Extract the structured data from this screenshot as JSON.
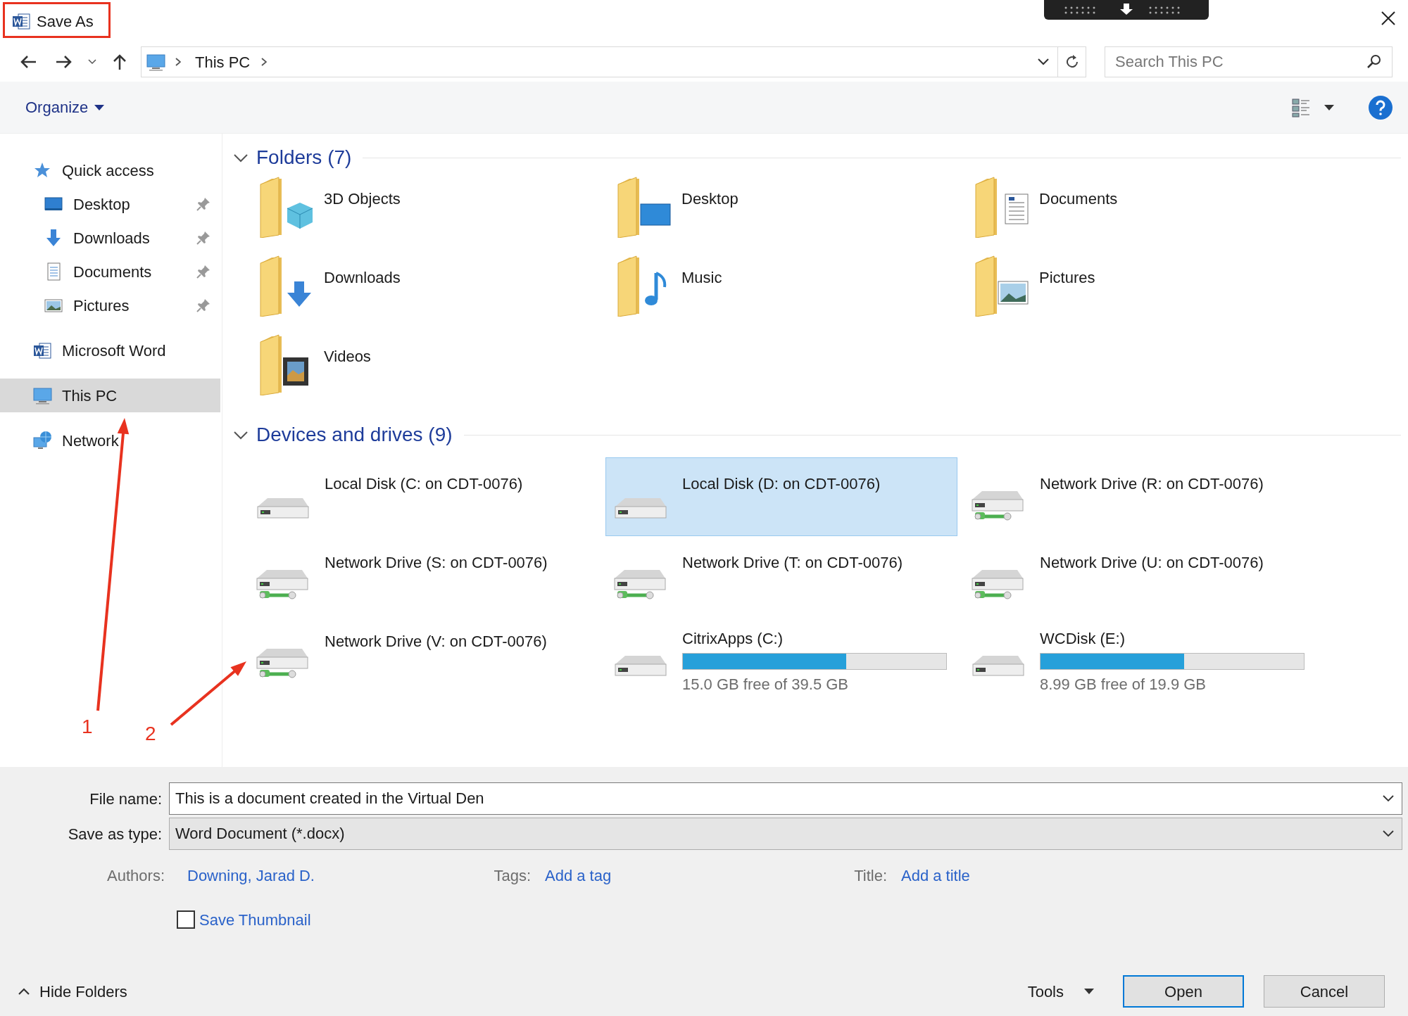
{
  "window": {
    "title": "Save As"
  },
  "address_bar": {
    "path": [
      "This PC"
    ],
    "search_placeholder": "Search This PC"
  },
  "toolbar": {
    "organize": "Organize"
  },
  "sidebar": {
    "items": [
      {
        "label": "Quick access",
        "kind": "star",
        "selected": false,
        "children": [
          {
            "label": "Desktop",
            "kind": "desktop",
            "selected": false,
            "pinned": true
          },
          {
            "label": "Downloads",
            "kind": "downloads",
            "selected": false,
            "pinned": true
          },
          {
            "label": "Documents",
            "kind": "documents",
            "selected": false,
            "pinned": true
          },
          {
            "label": "Pictures",
            "kind": "pictures",
            "selected": false,
            "pinned": true
          }
        ]
      },
      {
        "label": "Microsoft Word",
        "kind": "word",
        "selected": false
      },
      {
        "label": "This PC",
        "kind": "pc",
        "selected": true
      },
      {
        "label": "Network",
        "kind": "network",
        "selected": false
      }
    ]
  },
  "folders": {
    "header": "Folders (7)",
    "expanded": true,
    "items": [
      {
        "label": "3D Objects",
        "kind": "objects"
      },
      {
        "label": "Desktop",
        "kind": "desktop"
      },
      {
        "label": "Documents",
        "kind": "documents"
      },
      {
        "label": "Downloads",
        "kind": "downloads"
      },
      {
        "label": "Music",
        "kind": "music"
      },
      {
        "label": "Pictures",
        "kind": "pictures"
      },
      {
        "label": "Videos",
        "kind": "videos"
      }
    ]
  },
  "drives": {
    "header": "Devices and drives (9)",
    "expanded": true,
    "items": [
      {
        "label": "Local Disk (C: on CDT-0076)",
        "kind": "local",
        "selected": false
      },
      {
        "label": "Local Disk (D: on CDT-0076)",
        "kind": "local",
        "selected": true
      },
      {
        "label": "Network Drive (R: on CDT-0076)",
        "kind": "network",
        "selected": false
      },
      {
        "label": "Network Drive (S: on CDT-0076)",
        "kind": "network",
        "selected": false
      },
      {
        "label": "Network Drive (T: on CDT-0076)",
        "kind": "network",
        "selected": false
      },
      {
        "label": "Network Drive (U: on CDT-0076)",
        "kind": "network",
        "selected": false
      },
      {
        "label": "Network Drive (V: on CDT-0076)",
        "kind": "network",
        "selected": false
      },
      {
        "label": "CitrixApps (C:)",
        "kind": "local",
        "selected": false,
        "level": 0.62,
        "free": "15.0 GB free of 39.5 GB"
      },
      {
        "label": "WCDisk (E:)",
        "kind": "local",
        "selected": false,
        "level": 0.545,
        "free": "8.99 GB free of 19.9 GB"
      }
    ]
  },
  "form": {
    "file_name_label": "File name:",
    "file_name": "This is a document created in the Virtual Den",
    "type_label": "Save as type:",
    "type": "Word Document (*.docx)",
    "authors_label": "Authors:",
    "authors": "Downing, Jarad D.",
    "tags_label": "Tags:",
    "tags_placeholder": "Add a tag",
    "title_label": "Title:",
    "title_placeholder": "Add a title",
    "thumbnail": {
      "label": "Save Thumbnail",
      "checked": false
    }
  },
  "footer": {
    "hide_folders": "Hide Folders",
    "tools": "Tools",
    "buttons": [
      "Open",
      "Cancel"
    ]
  },
  "annotations": [
    {
      "label": "1"
    },
    {
      "label": "2"
    }
  ]
}
